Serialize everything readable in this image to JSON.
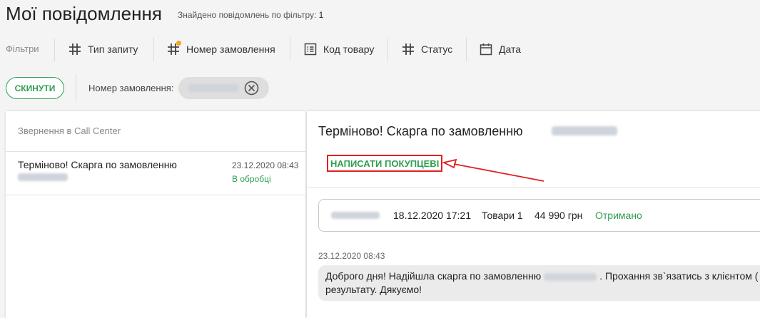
{
  "header": {
    "title": "Мої повідомлення",
    "found_label": "Знайдено повідомлень по фільтру:",
    "found_count": "1"
  },
  "filters": {
    "label": "Фільтри",
    "items": [
      {
        "label": "Тип запиту",
        "icon": "hash-icon"
      },
      {
        "label": "Номер замовлення",
        "icon": "hash-icon",
        "active": true
      },
      {
        "label": "Код товару",
        "icon": "barcode-list-icon"
      },
      {
        "label": "Статус",
        "icon": "hash-icon"
      },
      {
        "label": "Дата",
        "icon": "calendar-icon"
      }
    ],
    "active_dot_color": "#f5a623"
  },
  "active_filters": {
    "reset_label": "СКИНУТИ",
    "chip_label": "Номер замовлення:"
  },
  "list": {
    "header": "Звернення в Call Center",
    "items": [
      {
        "title": "Терміново! Скарга по замовленню",
        "datetime": "23.12.2020 08:43",
        "status": "В обробці"
      }
    ]
  },
  "detail": {
    "title": "Терміново! Скарга по замовленню",
    "write_button": "НАПИСАТИ ПОКУПЦЕВІ",
    "order": {
      "datetime": "18.12.2020 17:21",
      "items": "Товари 1",
      "amount": "44 990 грн",
      "status": "Отримано"
    },
    "message": {
      "datetime": "23.12.2020 08:43",
      "text_part1": "Доброго дня! Надійшла скарга по замовленню",
      "text_part2": ". Прохання зв`язатись з клієнтом (",
      "text_line2": "результату. Дякуємо!"
    }
  },
  "colors": {
    "accent_green": "#2f9e4f",
    "annotation_red": "#e02020"
  }
}
